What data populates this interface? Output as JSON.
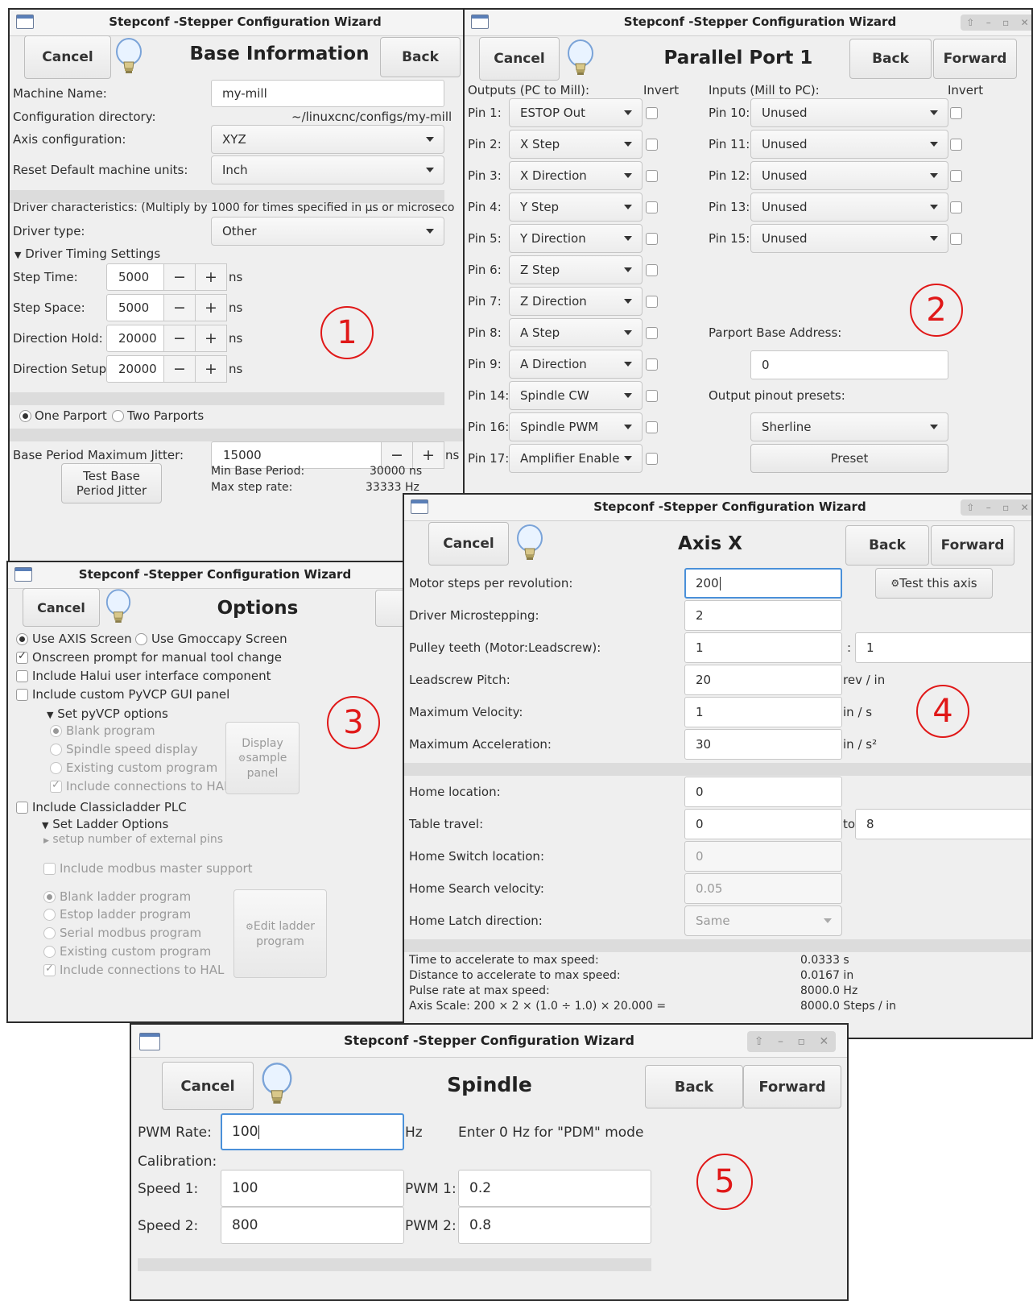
{
  "window_title": "Stepconf -Stepper Configuration Wizard",
  "buttons": {
    "cancel": "Cancel",
    "back": "Back",
    "forward": "Forward"
  },
  "w1": {
    "heading": "Base Information",
    "machine_name_label": "Machine Name:",
    "machine_name": "my-mill",
    "config_dir_label": "Configuration directory:",
    "config_dir": "~/linuxcnc/configs/my-mill",
    "axis_config_label": "Axis configuration:",
    "axis_config": "XYZ",
    "units_label": "Reset Default machine units:",
    "units": "Inch",
    "driver_char": "Driver characteristics: (Multiply by 1000 for times specified in µs or microseco",
    "driver_type_label": "Driver type:",
    "driver_type": "Other",
    "timing_expander": "Driver Timing Settings",
    "timing": [
      {
        "label": "Step Time:",
        "value": "5000",
        "unit": "ns"
      },
      {
        "label": "Step Space:",
        "value": "5000",
        "unit": "ns"
      },
      {
        "label": "Direction Hold:",
        "value": "20000",
        "unit": "ns"
      },
      {
        "label": "Direction Setup:",
        "value": "20000",
        "unit": "ns"
      }
    ],
    "one_parport": "One Parport",
    "two_parports": "Two Parports",
    "jitter_label": "Base Period Maximum Jitter:",
    "jitter": "15000",
    "jitter_unit": "ns",
    "test_jitter_line1": "Test Base",
    "test_jitter_line2": "Period Jitter",
    "min_base_period_label": "Min Base Period:",
    "min_base_period": "30000 ns",
    "max_step_rate_label": "Max step rate:",
    "max_step_rate": "33333 Hz",
    "annotation": "1"
  },
  "w2": {
    "heading": "Parallel Port 1",
    "outputs_header": "Outputs (PC to Mill):",
    "invert_header": "Invert",
    "inputs_header": "Inputs (Mill to PC):",
    "outputs": [
      {
        "pin": "Pin 1:",
        "value": "ESTOP Out"
      },
      {
        "pin": "Pin 2:",
        "value": "X Step"
      },
      {
        "pin": "Pin 3:",
        "value": "X Direction"
      },
      {
        "pin": "Pin 4:",
        "value": "Y Step"
      },
      {
        "pin": "Pin 5:",
        "value": "Y Direction"
      },
      {
        "pin": "Pin 6:",
        "value": "Z Step"
      },
      {
        "pin": "Pin 7:",
        "value": "Z Direction"
      },
      {
        "pin": "Pin 8:",
        "value": "A Step"
      },
      {
        "pin": "Pin 9:",
        "value": "A Direction"
      },
      {
        "pin": "Pin 14:",
        "value": "Spindle CW"
      },
      {
        "pin": "Pin 16:",
        "value": "Spindle PWM"
      },
      {
        "pin": "Pin 17:",
        "value": "Amplifier Enable"
      }
    ],
    "inputs": [
      {
        "pin": "Pin 10:",
        "value": "Unused"
      },
      {
        "pin": "Pin 11:",
        "value": "Unused"
      },
      {
        "pin": "Pin 12:",
        "value": "Unused"
      },
      {
        "pin": "Pin 13:",
        "value": "Unused"
      },
      {
        "pin": "Pin 15:",
        "value": "Unused"
      }
    ],
    "base_addr_label": "Parport Base Address:",
    "base_addr": "0",
    "presets_label": "Output pinout presets:",
    "preset_select": "Sherline",
    "preset_button": "Preset",
    "annotation": "2"
  },
  "w3": {
    "heading": "Options",
    "back_partial": "B",
    "axis_screen": "Use AXIS Screen",
    "gmoccapy_screen": "Use Gmoccapy Screen",
    "onscreen_prompt": "Onscreen prompt for manual tool change",
    "halui": "Include Halui user interface component",
    "pyvcp": "Include custom PyVCP GUI panel",
    "pyvcp_options": "Set pyVCP options",
    "blank_program": "Blank program",
    "spindle_display": "Spindle speed display",
    "existing_program": "Existing custom program",
    "include_hal": "Include connections to HAL",
    "display_sample_1": "Display",
    "display_sample_2": "sample",
    "display_sample_3": "panel",
    "classicladder": "Include Classicladder PLC",
    "ladder_options": "Set Ladder Options",
    "ext_pins": "setup number of external pins",
    "modbus_master": "Include modbus master support",
    "blank_ladder": "Blank ladder program",
    "estop_ladder": "Estop ladder program",
    "serial_modbus": "Serial modbus program",
    "existing_custom": "Existing custom program",
    "include_hal2": "Include connections to HAL",
    "edit_ladder_1": "Edit ladder",
    "edit_ladder_2": "program",
    "annotation": "3"
  },
  "w4": {
    "heading": "Axis X",
    "test_axis": "Test this axis",
    "rows": [
      {
        "label": "Motor steps per revolution:",
        "value": "200",
        "unit": ""
      },
      {
        "label": "Driver Microstepping:",
        "value": "2",
        "unit": ""
      },
      {
        "label": "Pulley teeth (Motor:Leadscrew):",
        "value": "1",
        "unit": ":"
      },
      {
        "label": "Leadscrew Pitch:",
        "value": "20",
        "unit": "rev / in"
      },
      {
        "label": "Maximum Velocity:",
        "value": "1",
        "unit": "in / s"
      },
      {
        "label": "Maximum Acceleration:",
        "value": "30",
        "unit": "in / s²"
      }
    ],
    "pulley_second": "1",
    "home_location_label": "Home location:",
    "home_location": "0",
    "table_travel_label": "Table travel:",
    "table_travel_from": "0",
    "table_travel_to_label": "to",
    "table_travel_to": "8",
    "home_switch_label": "Home Switch location:",
    "home_switch": "0",
    "home_search_label": "Home Search velocity:",
    "home_search": "0.05",
    "home_latch_label": "Home Latch direction:",
    "home_latch": "Same",
    "stats": [
      {
        "label": "Time to accelerate to max speed:",
        "value": "0.0333 s"
      },
      {
        "label": "Distance to accelerate to max speed:",
        "value": "0.0167 in"
      },
      {
        "label": "Pulse rate at max speed:",
        "value": "8000.0 Hz"
      },
      {
        "label": "Axis Scale: 200 × 2 × (1.0 ÷ 1.0) × 20.000 =",
        "value": "8000.0 Steps / in"
      }
    ],
    "annotation": "4"
  },
  "w5": {
    "heading": "Spindle",
    "pwm_rate_label": "PWM Rate:",
    "pwm_rate": "100",
    "pwm_rate_unit": "Hz",
    "pdm_hint": "Enter 0 Hz for \"PDM\" mode",
    "calibration": "Calibration:",
    "speed1_label": "Speed 1:",
    "speed1": "100",
    "pwm1_label": "PWM 1:",
    "pwm1": "0.2",
    "speed2_label": "Speed 2:",
    "speed2": "800",
    "pwm2_label": "PWM 2:",
    "pwm2": "0.8",
    "annotation": "5"
  },
  "window_controls": [
    "⇧",
    "–",
    "▫",
    "✕"
  ]
}
